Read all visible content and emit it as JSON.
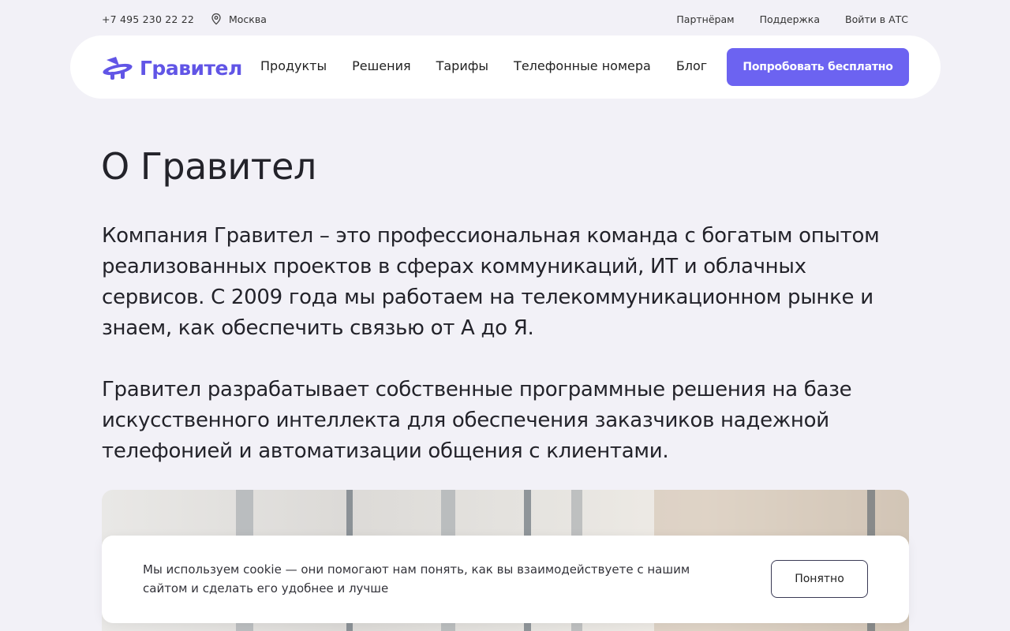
{
  "topbar": {
    "phone": "+7 495 230 22 22",
    "city": "Москва",
    "city_icon": "location-pin-icon",
    "links": [
      "Партнёрам",
      "Поддержка",
      "Войти в АТС"
    ]
  },
  "header": {
    "logo_text": "Гравител",
    "logo_icon": "gravitel-logo-icon",
    "menu": [
      "Продукты",
      "Решения",
      "Тарифы",
      "Телефонные номера",
      "Блог"
    ],
    "cta_label": "Попробовать бесплатно"
  },
  "main": {
    "title": "О Гравител",
    "paragraph1": "Компания Гравител – это профессиональная команда с богатым опытом реализованных проектов в сферах коммуникаций, ИТ и облачных сервисов. С 2009 года мы работаем на телекоммуникационном рынке и знаем, как обеспечить связью от А до Я.",
    "paragraph2": "Гравител разрабатывает собственные программные решения на базе искусственного интеллекта для обеспечения заказчиков надежной телефонией и автоматизации общения с клиентами."
  },
  "cookie_banner": {
    "text": "Мы используем cookie — они помогают нам понять, как вы взаимодействуете с нашим сайтом и сделать его удобнее и лучше",
    "button_label": "Понятно"
  },
  "colors": {
    "background": "#f2f1f7",
    "accent": "#6c63f1",
    "logo": "#6155e6"
  }
}
